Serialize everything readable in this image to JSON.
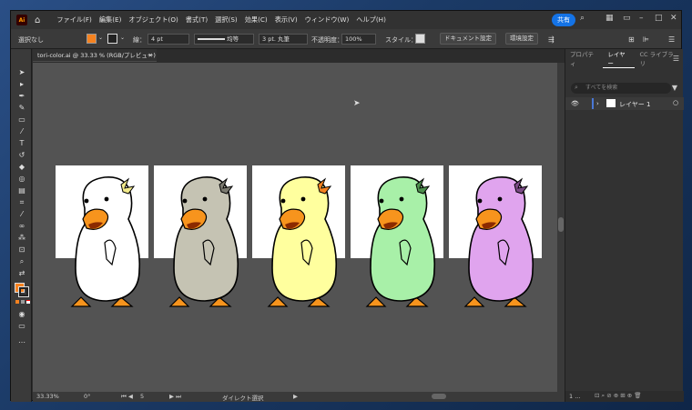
{
  "app": {
    "logo": "Ai"
  },
  "menu": [
    "ファイル(F)",
    "編集(E)",
    "オブジェクト(O)",
    "書式(T)",
    "選択(S)",
    "効果(C)",
    "表示(V)",
    "ウィンドウ(W)",
    "ヘルプ(H)"
  ],
  "share_label": "共有",
  "control": {
    "selection": "選択なし",
    "stroke_label": "線：",
    "stroke_value": "4 pt",
    "stroke_style": "均等",
    "brush": "3 pt. 丸筆",
    "opacity_label": "不透明度：",
    "opacity_value": "100%",
    "style_label": "スタイル：",
    "doc_settings": "ドキュメント設定",
    "prefs": "環境設定"
  },
  "document_tab": {
    "title": "tori-color.ai @ 33.33 % (RGB/プレビュー)"
  },
  "panel": {
    "tabs": [
      "プロパティ",
      "レイヤー",
      "CC ライブラリ"
    ],
    "search_placeholder": "すべてを検索",
    "layer_name": "レイヤー 1",
    "footer_count": "1 ..."
  },
  "status": {
    "zoom": "33.33%",
    "rotation": "0°",
    "artboard": "5",
    "tool": "ダイレクト選択"
  },
  "colors": {
    "fill": "#f58220",
    "accent": "#1473e6"
  },
  "artboards": [
    {
      "body": "#ffffff",
      "crest": "#f3eb8c"
    },
    {
      "body": "#c5c3b3",
      "crest": "#7b7a70"
    },
    {
      "body": "#ffff9e",
      "crest": "#f58220"
    },
    {
      "body": "#a8f0a8",
      "crest": "#4d8f4d"
    },
    {
      "body": "#e0a4ee",
      "crest": "#7b4a86"
    }
  ]
}
